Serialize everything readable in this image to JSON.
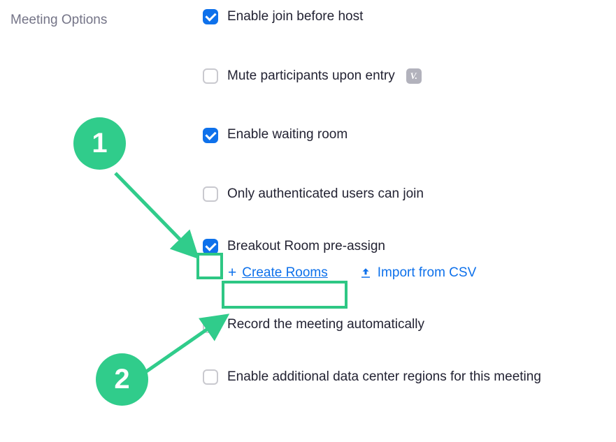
{
  "sectionLabel": "Meeting Options",
  "options": {
    "joinBeforeHost": {
      "label": "Enable join before host",
      "checked": true
    },
    "muteOnEntry": {
      "label": "Mute participants upon entry",
      "checked": false,
      "hasInfo": true
    },
    "waitingRoom": {
      "label": "Enable waiting room",
      "checked": true
    },
    "authOnly": {
      "label": "Only authenticated users can join",
      "checked": false
    },
    "breakoutPre": {
      "label": "Breakout Room pre-assign",
      "checked": true
    },
    "recordAuto": {
      "label": "Record the meeting automatically",
      "checked": false
    },
    "dataCenter": {
      "label": "Enable additional data center regions for this meeting",
      "checked": false
    }
  },
  "sublinks": {
    "createRooms": "Create Rooms",
    "importCsv": "Import from CSV"
  },
  "annotations": {
    "badge1": "1",
    "badge2": "2"
  },
  "colors": {
    "accent": "#0E71EB",
    "highlight": "#30cc8b",
    "label": "#747487"
  }
}
